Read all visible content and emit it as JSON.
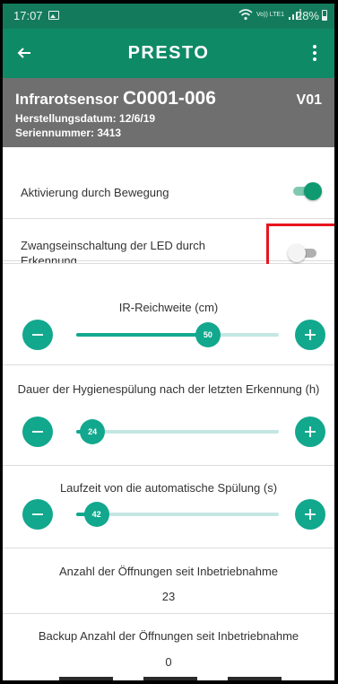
{
  "status": {
    "time": "17:07",
    "lte": "Vo)) LTE1",
    "battery": "28%"
  },
  "appbar": {
    "title": "PRESTO"
  },
  "device": {
    "name_prefix": "Infrarotsensor ",
    "code": "C0001-006",
    "version": "V01",
    "date": "Herstellungsdatum: 12/6/19",
    "serial": "Seriennummer: 3413"
  },
  "settings": {
    "motion": {
      "label": "Aktivierung durch Bewegung",
      "on": true
    },
    "led": {
      "label": "Zwangseinschaltung der LED durch Erkennung",
      "on": false
    }
  },
  "sliders": [
    {
      "title": "IR-Reichweite (cm)",
      "value": "50",
      "fraction": 0.65
    },
    {
      "title": "Dauer der Hygienespülung nach der letzten Erkennung (h)",
      "value": "24",
      "fraction": 0.08
    },
    {
      "title": "Laufzeit von die automatische Spülung (s)",
      "value": "42",
      "fraction": 0.1
    }
  ],
  "stats": {
    "openings_label": "Anzahl der Öffnungen seit Inbetriebnahme",
    "openings_value": "23",
    "backup_label": "Backup Anzahl der Öffnungen seit Inbetriebnahme",
    "backup_value": "0"
  },
  "colors": {
    "statusbar": "#137b5b",
    "appbar": "#0f8a66",
    "accent": "#12a88d",
    "header": "#6f6f6f",
    "highlight": "#e8141c"
  }
}
